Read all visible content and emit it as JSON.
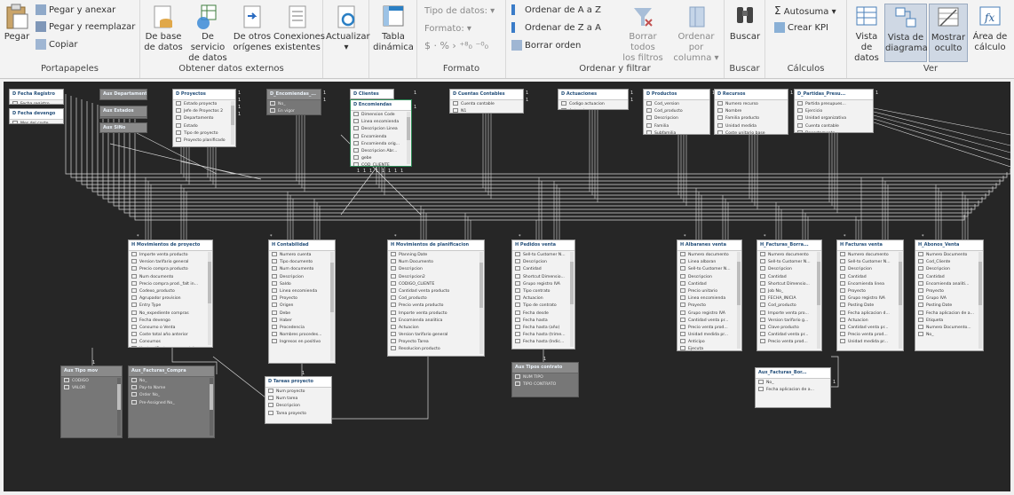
{
  "ribbon": {
    "portapapeles": {
      "label": "Portapapeles",
      "paste": "Pegar",
      "paste_append": "Pegar y anexar",
      "paste_replace": "Pegar y reemplazar",
      "copy": "Copiar"
    },
    "external": {
      "label": "Obtener datos externos",
      "db_line1": "De base",
      "db_line2": "de datos",
      "svc_line1": "De servicio",
      "svc_line2": "de datos",
      "other_line1": "De otros",
      "other_line2": "orígenes",
      "conn_line1": "Conexiones",
      "conn_line2": "existentes"
    },
    "refresh": {
      "label": "Actualizar"
    },
    "pivot": {
      "line1": "Tabla",
      "line2": "dinámica"
    },
    "formato": {
      "label": "Formato",
      "data_type": "Tipo de datos:",
      "format": "Formato:",
      "symbols": "$ · % ›"
    },
    "orden": {
      "label": "Ordenar y filtrar",
      "sort_az": "Ordenar de A a Z",
      "sort_za": "Ordenar de Z a A",
      "clear_sort": "Borrar orden",
      "clear_filters_l1": "Borrar todos",
      "clear_filters_l2": "los filtros",
      "sort_by_l1": "Ordenar por",
      "sort_by_l2": "columna"
    },
    "buscar": {
      "label": "Buscar",
      "button": "Buscar"
    },
    "calculos": {
      "label": "Cálculos",
      "autosum": "Autosuma",
      "kpi": "Crear KPI"
    },
    "ver": {
      "label": "Ver",
      "data_view_l1": "Vista de",
      "data_view_l2": "datos",
      "diagram_l1": "Vista de",
      "diagram_l2": "diagrama",
      "hidden_l1": "Mostrar",
      "hidden_l2": "oculto",
      "calc_l1": "Área de",
      "calc_l2": "cálculo"
    }
  },
  "tables": [
    {
      "id": "t_fecha_reg",
      "title": "D Fecha Registro",
      "fields": [
        "Fecha registro"
      ],
      "dark": false
    },
    {
      "id": "t_fecha_dev",
      "title": "D Fecha devengo",
      "fields": [
        "Mes del coste"
      ],
      "dark": false
    },
    {
      "id": "t_aux_dep",
      "title": "Aux Departamentos",
      "fields": [],
      "dark": true
    },
    {
      "id": "t_aux_est",
      "title": "Aux Estados",
      "fields": [
        "Cod. estado"
      ],
      "dark": true
    },
    {
      "id": "t_aux_sino",
      "title": "Aux SiNo",
      "fields": [
        "..."
      ],
      "dark": true
    },
    {
      "id": "t_proyectos",
      "title": "D Proyectos",
      "fields": [
        "Estado proyecto",
        "Jefe de Proyectos 2",
        "Departamento",
        "Estado",
        "Tipo de proyecto",
        "Proyecto planificado"
      ],
      "dark": false
    },
    {
      "id": "t_encomiendas_top",
      "title": "D_Encomiendas_...",
      "fields": [
        "No_",
        "En vigor"
      ],
      "dark": true
    },
    {
      "id": "t_clientes",
      "title": "D Clientes",
      "fields": [],
      "dark": false
    },
    {
      "id": "t_encomiendas",
      "title": "D Encomiendas",
      "fields": [
        "Dimension Code",
        "Linea encomienda",
        "Descripcion Linea",
        "Encomienda",
        "Encomienda orig...",
        "Descripcion Abr...",
        "gebe",
        "COD_CLIENTE"
      ],
      "dark": false
    },
    {
      "id": "t_cuentas",
      "title": "D Cuentas Contables",
      "fields": [
        "Cuenta contable",
        "N1",
        "N2"
      ],
      "dark": false
    },
    {
      "id": "t_actuaciones",
      "title": "D Actuaciones",
      "fields": [
        "Codigo actuacion",
        "Actuacion"
      ],
      "dark": false
    },
    {
      "id": "t_productos",
      "title": "D Productos",
      "fields": [
        "Cod_version",
        "Cod_producto",
        "Descripcion",
        "Familia",
        "Subfamilia"
      ],
      "dark": false
    },
    {
      "id": "t_recursos",
      "title": "D Recursos",
      "fields": [
        "Numero recurso",
        "Nombre",
        "Familia producto",
        "Unidad medida",
        "Coste unitario base"
      ],
      "dark": false
    },
    {
      "id": "t_partidas",
      "title": "D_Partidas_Presu...",
      "fields": [
        "Partida presupues...",
        "Ejercicio",
        "Unidad organizativa",
        "Cuenta contable",
        "Departamento"
      ],
      "dark": false
    },
    {
      "id": "t_mov_proy",
      "title": "H Movimientos de proyecto",
      "fields": [
        "Importe venta producto",
        "Version tarifario general",
        "Precio compra producto",
        "Num documento",
        "Precio compra prod._falt in...",
        "Codexo_producto",
        "Agrupador provision",
        "Entry Type",
        "No_expediente compras",
        "Fecha devengo",
        "Consumo o Venta",
        "Coste total año anterior",
        "Consumos",
        "Ventas (Coste mvos venta)"
      ],
      "dark": false
    },
    {
      "id": "t_contab",
      "title": "H Contabilidad",
      "fields": [
        "Numero cuenta",
        "Tipo documento",
        "Num documento",
        "Descripcion",
        "Saldo",
        "Linea encomienda",
        "Proyecto",
        "Origen",
        "Debe",
        "Haber",
        "Procedencia",
        "Nombres procedes...",
        "Ingresos en positivo"
      ],
      "dark": false
    },
    {
      "id": "t_mov_plan",
      "title": "H Movimientos de planificacion",
      "fields": [
        "Planning Date",
        "Num Documento",
        "Descripcion",
        "Descripcion2",
        "CODIGO_CLIENTE",
        "Cantidad venta producto",
        "Cod_producto",
        "Precio venta producto",
        "Importe venta producto",
        "Encomienda analitica",
        "Actuacion",
        "Version tarifario general",
        "Proyecto Tarea",
        "Resolucion producto"
      ],
      "dark": false
    },
    {
      "id": "t_pedidos",
      "title": "H Pedidos venta",
      "fields": [
        "Sell-to Customer N...",
        "Descripcion",
        "Cantidad",
        "Shortcut Dimensio...",
        "Grupo registro IVA",
        "Tipo contrato",
        "Actuacion",
        "Tipo de contrato",
        "Fecha desde",
        "Fecha hasta",
        "Fecha hasta (año)",
        "Fecha hasta (trime...",
        "Fecha hasta (Indic..."
      ],
      "dark": false
    },
    {
      "id": "t_albaranes",
      "title": "H Albaranes venta",
      "fields": [
        "Numero documento",
        "Linea albaran",
        "Sell-to Customer N...",
        "Descripcion",
        "Cantidad",
        "Precio unitario",
        "Linea encomienda",
        "Proyecto",
        "Grupo registro IVA",
        "Cantidad venta pr...",
        "Precio venta prod...",
        "Unidad medida pr...",
        "Anticipo",
        "Ejecuta"
      ],
      "dark": false
    },
    {
      "id": "t_fact_borr",
      "title": "H_Facturas_Borra...",
      "fields": [
        "Numero documento",
        "Sell-to Customer N...",
        "Descripcion",
        "Cantidad",
        "Shortcut Dimensio...",
        "Job No_",
        "FECHA_INICIA",
        "Cod_producto",
        "Importe venta pro...",
        "Version tarifario g...",
        "Clave producto",
        "Cantidad venta pr...",
        "Precio venta prod..."
      ],
      "dark": false
    },
    {
      "id": "t_fact_venta",
      "title": "H Facturas venta",
      "fields": [
        "Numero documento",
        "Sell-to Customer N...",
        "Descripcion",
        "Cantidad",
        "Encomienda linea",
        "Proyecto",
        "Grupo registro IVA",
        "Posting Date",
        "Fecha aplicacion d...",
        "Actuacion",
        "Cantidad venta pr...",
        "Precio venta prod...",
        "Unidad medida pr..."
      ],
      "dark": false
    },
    {
      "id": "t_abonos",
      "title": "H_Abonos_Venta",
      "fields": [
        "Numero Documento",
        "Cod_Cliente",
        "Descripcion",
        "Cantidad",
        "Encomienda analiti...",
        "Proyecto",
        "Grupo IVA",
        "Posting Date",
        "Fecha aplicacion de a...",
        "Etiqueta",
        "Numero Documento...",
        "No_"
      ],
      "dark": false
    },
    {
      "id": "t_aux_tipo_mov",
      "title": "Aux Tipo mov",
      "fields": [
        "CODIGO",
        "VALOR"
      ],
      "dark": true
    },
    {
      "id": "t_aux_fact_compra",
      "title": "Aux_Facturas_Compra",
      "fields": [
        "No_",
        "Pay-to Name",
        "Order No_",
        "Pre-Assigned No_"
      ],
      "dark": true
    },
    {
      "id": "t_tareas",
      "title": "D Tareas proyecto",
      "fields": [
        "Num proyecto",
        "Num tarea",
        "Descripcion",
        "Tarea proyecto"
      ],
      "dark": false
    },
    {
      "id": "t_aux_tipo_contr",
      "title": "Aux Tipos contrato",
      "fields": [
        "NUM TIPO",
        "TIPO CONTRATO"
      ],
      "dark": true
    },
    {
      "id": "t_aux_fact_borr",
      "title": "Aux_Facturas_Bor...",
      "fields": [
        "No_",
        "Fecha aplicacion de a..."
      ],
      "dark": false
    }
  ]
}
